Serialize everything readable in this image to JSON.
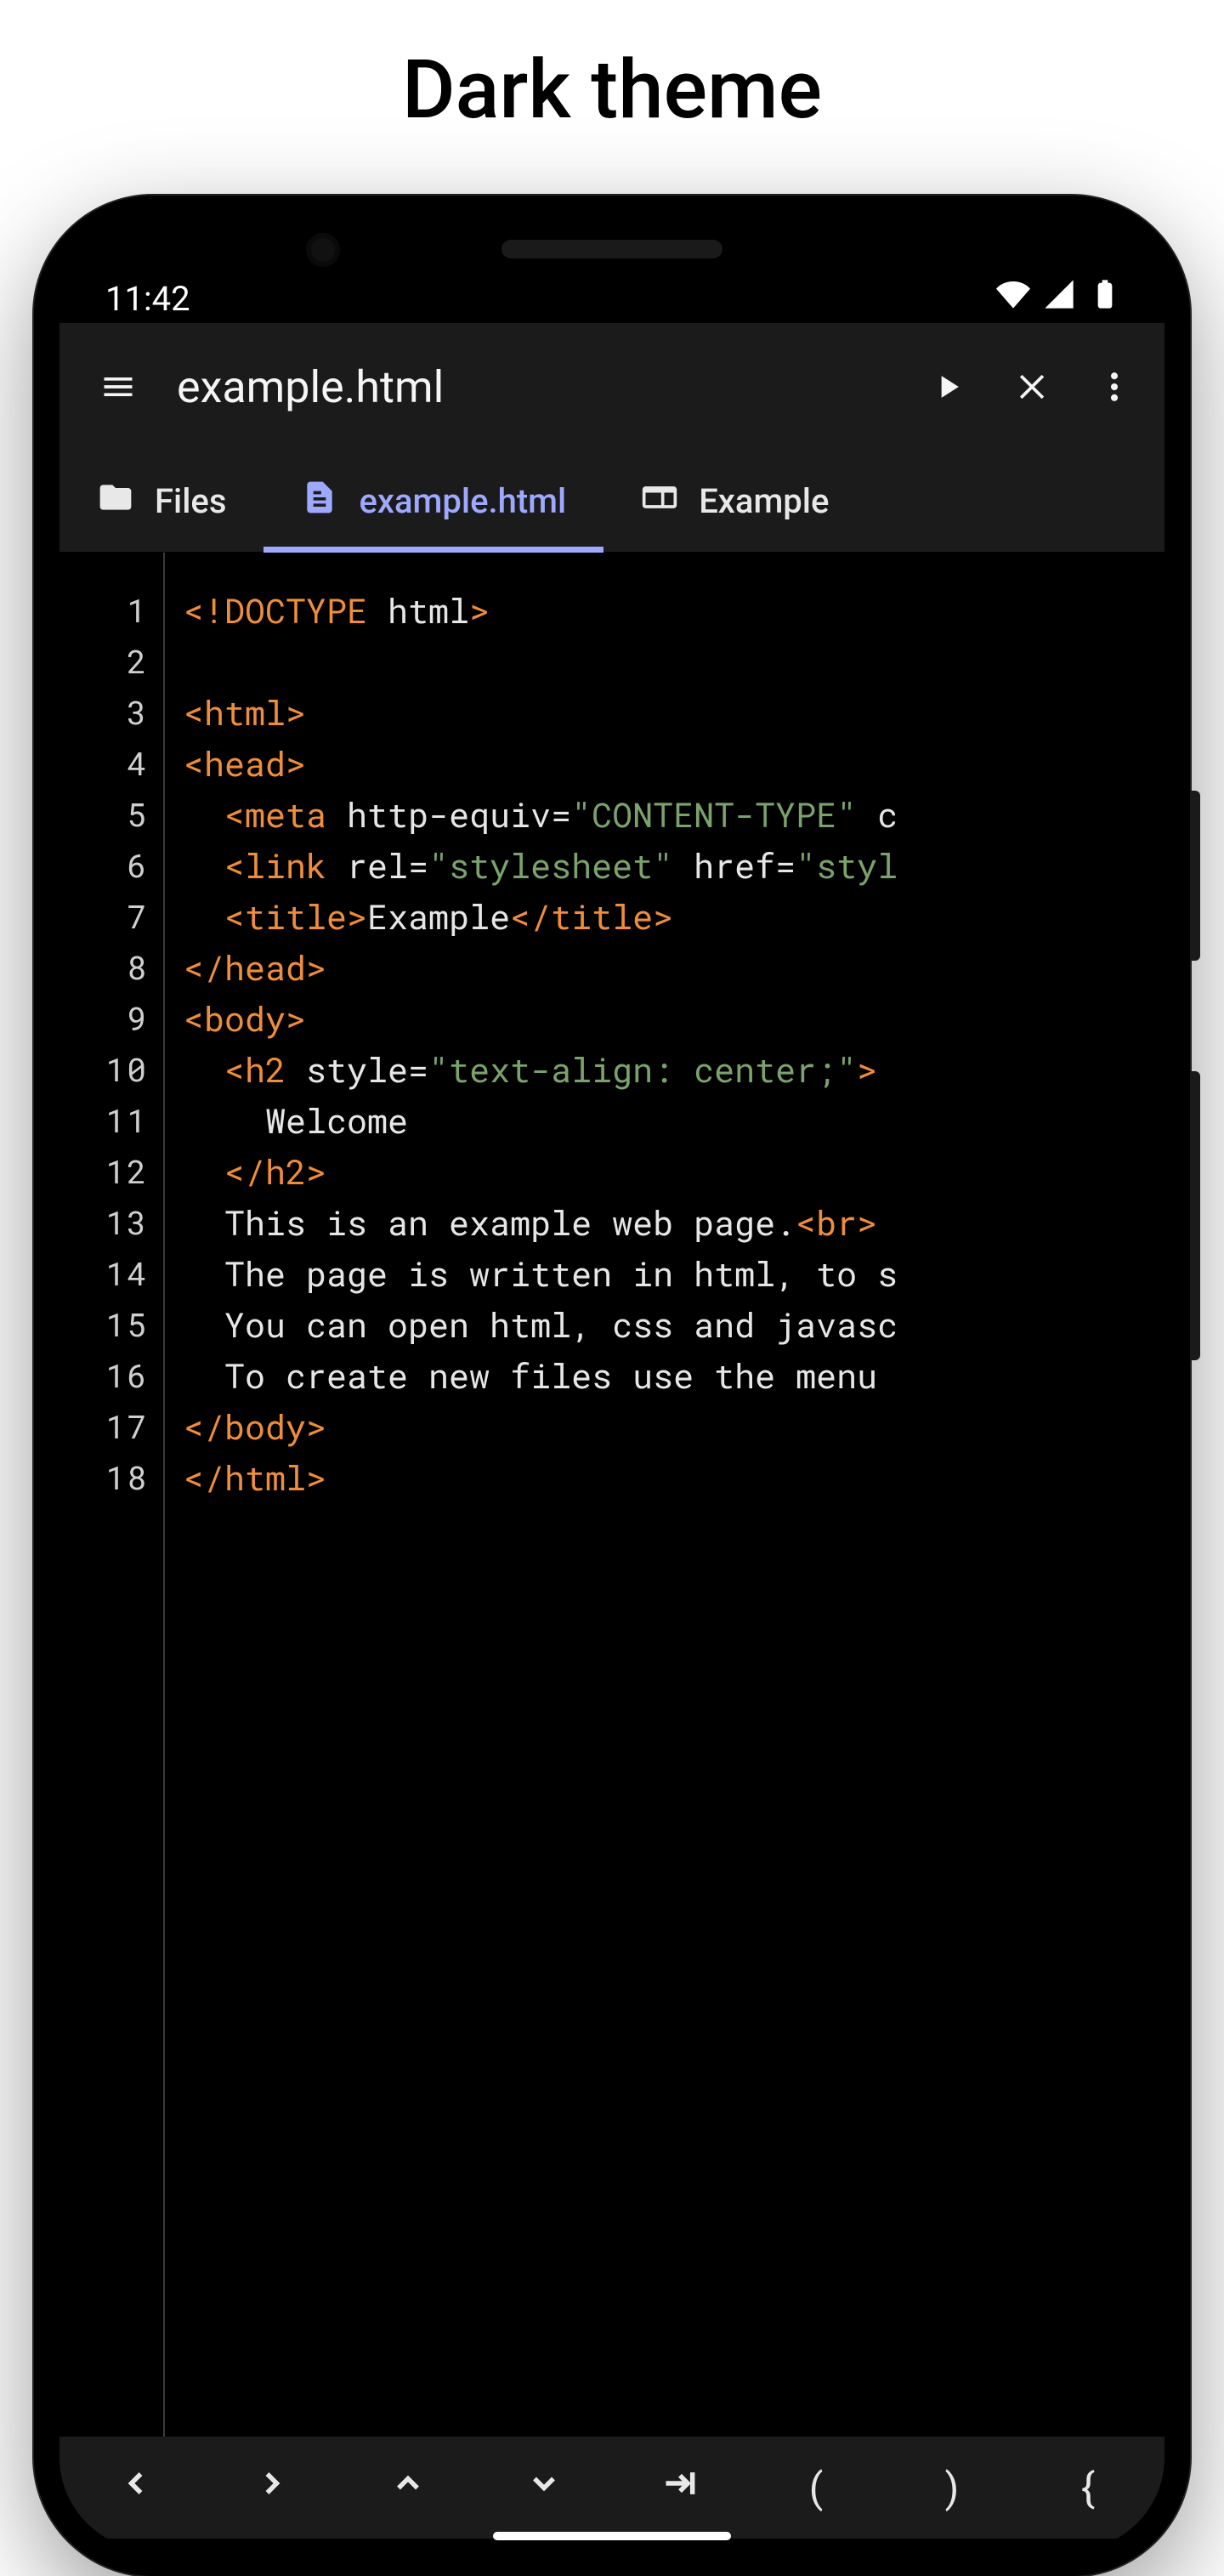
{
  "page_heading": "Dark theme",
  "status": {
    "time": "11:42"
  },
  "appbar": {
    "title": "example.html"
  },
  "tabs": [
    {
      "label": "Files",
      "icon": "folder-icon",
      "active": false
    },
    {
      "label": "example.html",
      "icon": "document-icon",
      "active": true
    },
    {
      "label": "Example",
      "icon": "web-icon",
      "active": false
    }
  ],
  "editor": {
    "line_numbers": [
      "1",
      "2",
      "3",
      "4",
      "5",
      "6",
      "7",
      "8",
      "9",
      "10",
      "11",
      "12",
      "13",
      "14",
      "15",
      "16",
      "17",
      "18"
    ],
    "lines": [
      [
        [
          "<!DOCTYPE",
          "tag"
        ],
        [
          " html",
          "txt"
        ],
        [
          ">",
          "tag"
        ]
      ],
      [],
      [
        [
          "<html>",
          "tag"
        ]
      ],
      [
        [
          "<head>",
          "tag"
        ]
      ],
      [
        [
          "  ",
          "txt"
        ],
        [
          "<meta",
          "tag"
        ],
        [
          " http-equiv=",
          "attr"
        ],
        [
          "\"CONTENT-TYPE\"",
          "str"
        ],
        [
          " c",
          "attr"
        ]
      ],
      [
        [
          "  ",
          "txt"
        ],
        [
          "<link",
          "tag"
        ],
        [
          " rel=",
          "attr"
        ],
        [
          "\"stylesheet\"",
          "str"
        ],
        [
          " href=",
          "attr"
        ],
        [
          "\"styl",
          "str"
        ]
      ],
      [
        [
          "  ",
          "txt"
        ],
        [
          "<title>",
          "tag"
        ],
        [
          "Example",
          "txt"
        ],
        [
          "</title>",
          "tag"
        ]
      ],
      [
        [
          "</head>",
          "tag"
        ]
      ],
      [
        [
          "<body>",
          "tag"
        ]
      ],
      [
        [
          "  ",
          "txt"
        ],
        [
          "<h2",
          "tag"
        ],
        [
          " style=",
          "attr"
        ],
        [
          "\"text-align: center;\"",
          "str"
        ],
        [
          ">",
          "tag"
        ]
      ],
      [
        [
          "    Welcome",
          "txt"
        ]
      ],
      [
        [
          "  ",
          "txt"
        ],
        [
          "</h2>",
          "tag"
        ]
      ],
      [
        [
          "  This is an example web page.",
          "txt"
        ],
        [
          "<br>",
          "tag"
        ]
      ],
      [
        [
          "  The page is written in html, to s",
          "txt"
        ]
      ],
      [
        [
          "  You can open html, css and javasc",
          "txt"
        ]
      ],
      [
        [
          "  To create new files use the menu ",
          "txt"
        ]
      ],
      [
        [
          "</body>",
          "tag"
        ]
      ],
      [
        [
          "</html>",
          "tag"
        ]
      ]
    ]
  },
  "symbols": [
    "‹",
    "›",
    "ˆ",
    "ˇ",
    "→|",
    "(",
    ")",
    "{"
  ]
}
